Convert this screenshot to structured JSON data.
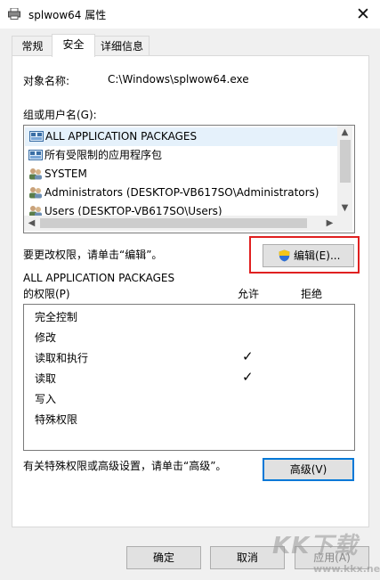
{
  "window": {
    "title": "splwow64 属性",
    "close_glyph": "✕"
  },
  "tabs": [
    {
      "label": "常规"
    },
    {
      "label": "安全",
      "active": true
    },
    {
      "label": "详细信息"
    }
  ],
  "object": {
    "label": "对象名称:",
    "value": "C:\\Windows\\splwow64.exe"
  },
  "groups": {
    "label": "组或用户名(G):",
    "items": [
      {
        "name": "ALL APPLICATION PACKAGES",
        "icon": "app-package-icon",
        "selected": true
      },
      {
        "name": "所有受限制的应用程序包",
        "icon": "app-package-icon"
      },
      {
        "name": "SYSTEM",
        "icon": "users-group-icon"
      },
      {
        "name": "Administrators (DESKTOP-VB617SO\\Administrators)",
        "icon": "users-group-icon"
      },
      {
        "name": "Users (DESKTOP-VB617SO\\Users)",
        "icon": "users-group-icon"
      }
    ]
  },
  "edit": {
    "hint": "要更改权限，请单击“编辑”。",
    "button_label": "编辑(E)..."
  },
  "permissions": {
    "for_label_line1": "ALL APPLICATION PACKAGES",
    "for_label_line2": "的权限(P)",
    "allow_header": "允许",
    "deny_header": "拒绝",
    "rows": [
      {
        "name": "完全控制",
        "allow": false,
        "deny": false
      },
      {
        "name": "修改",
        "allow": false,
        "deny": false
      },
      {
        "name": "读取和执行",
        "allow": true,
        "deny": false
      },
      {
        "name": "读取",
        "allow": true,
        "deny": false
      },
      {
        "name": "写入",
        "allow": false,
        "deny": false
      },
      {
        "name": "特殊权限",
        "allow": false,
        "deny": false
      }
    ],
    "check_glyph": "✓"
  },
  "advanced": {
    "hint": "有关特殊权限或高级设置，请单击“高级”。",
    "button_label": "高级(V)"
  },
  "footer": {
    "ok_label": "确定",
    "cancel_label": "取消",
    "apply_label": "应用(A)"
  },
  "watermark": {
    "text": "KK下载",
    "url": "www.kkx.net"
  },
  "colors": {
    "accent": "#0078d7",
    "highlight_box": "#e02020",
    "selection": "#e5f1fb"
  }
}
